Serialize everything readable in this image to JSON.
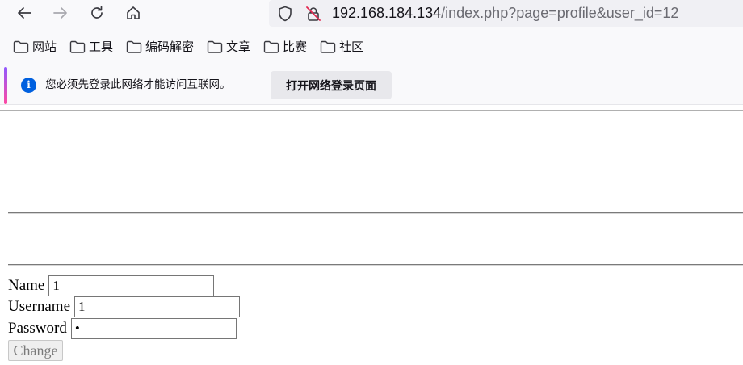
{
  "browser": {
    "url_host": "192.168.184.134",
    "url_path": "/index.php?page=profile&user_id=12"
  },
  "bookmarks": [
    {
      "label": "网站"
    },
    {
      "label": "工具"
    },
    {
      "label": "编码解密"
    },
    {
      "label": "文章"
    },
    {
      "label": "比赛"
    },
    {
      "label": "社区"
    }
  ],
  "notice": {
    "message": "您必须先登录此网络才能访问互联网。",
    "button_label": "打开网络登录页面"
  },
  "form": {
    "name_label": "Name",
    "name_value": "1",
    "username_label": "Username",
    "username_value": "1",
    "password_label": "Password",
    "password_value": "1",
    "submit_label": "Change"
  }
}
